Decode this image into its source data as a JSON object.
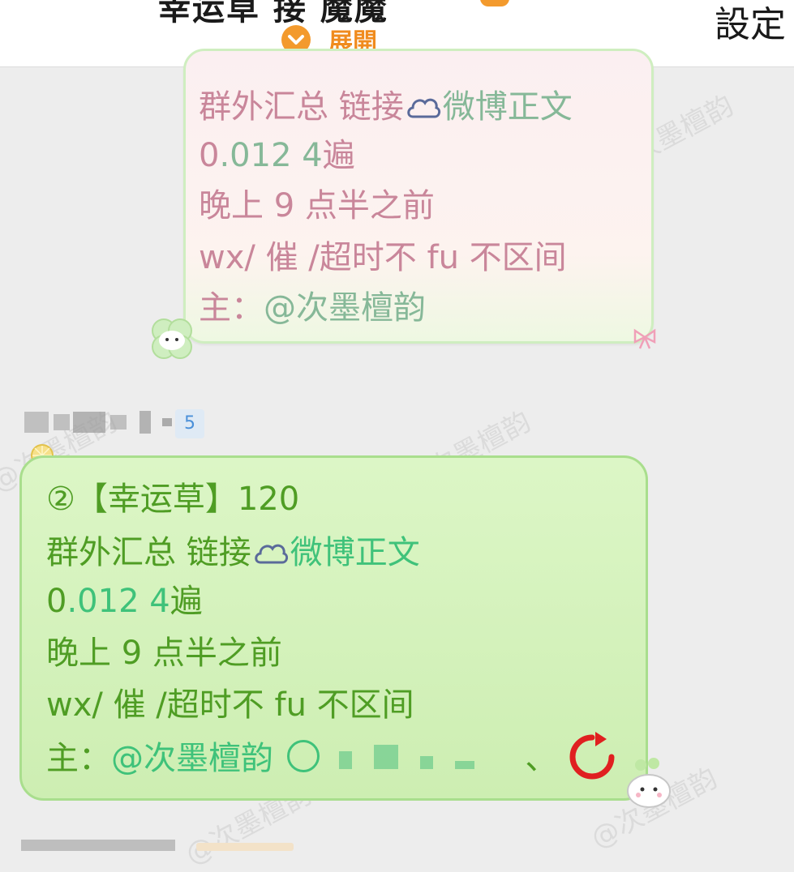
{
  "header": {
    "title": "幸运草 接 魔魔",
    "expand_label": "展開",
    "settings_label": "設定"
  },
  "watermark": "@次墨檀韵",
  "message_prev": {
    "lines": [
      {
        "a": "群外汇总 链接",
        "b": "微博正文"
      },
      {
        "a": "0",
        "b": ".012 4",
        "c": "遍"
      },
      {
        "a": "晚上 9 点半之前"
      },
      {
        "a": "wx/ 催 /超时不 fu 不区间"
      },
      {
        "a": "主：",
        "b": "@次墨檀韵"
      }
    ]
  },
  "sender": {
    "level": "5"
  },
  "message_main": {
    "lines": [
      {
        "a": "②【幸运草】120"
      },
      {
        "a": "群外汇总 链接",
        "b": "微博正文"
      },
      {
        "a": "0",
        "b": ".012 4",
        "c": "遍"
      },
      {
        "a": "晚上 9 点半之前"
      },
      {
        "a": "wx/ 催 /超时不 fu 不区间"
      },
      {
        "a": "主：",
        "b": "@次墨檀韵",
        "c": "、"
      }
    ]
  },
  "colors": {
    "accent_orange": "#f39a2d",
    "bubble_green_border": "#a9de8d",
    "text_green": "#4f9d24",
    "text_pink": "#c9869a",
    "refresh_red": "#e02020"
  },
  "icons": [
    "chevron-down-icon",
    "cloud-icon",
    "refresh-icon",
    "clover-sticker-icon",
    "bear-sticker-icon",
    "ribbon-icon"
  ]
}
